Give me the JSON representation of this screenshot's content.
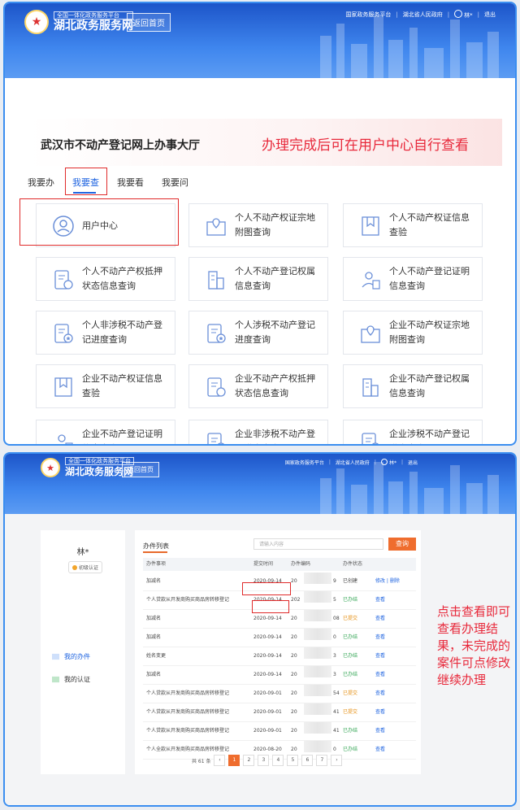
{
  "header": {
    "logo_top": "全国一体化政务服务平台",
    "logo_main": "湖北政务服务网",
    "home_button": "返回首页",
    "links": [
      "国家政务服务平台",
      "湖北省人民政府"
    ],
    "user": "林*",
    "logout": "退出"
  },
  "hall": {
    "title": "武汉市不动产登记网上办事大厅",
    "annotation": "办理完成后可在用户中心自行查看",
    "tabs": [
      "我要办",
      "我要查",
      "我要看",
      "我要问"
    ],
    "active_tab": "我要查"
  },
  "cards": [
    {
      "label": "用户中心",
      "icon": "user-circle-icon"
    },
    {
      "label": "个人不动产权证宗地附图查询",
      "icon": "map-pin-icon"
    },
    {
      "label": "个人不动产权证信息查验",
      "icon": "bookmark-icon"
    },
    {
      "label": "个人不动产产权抵押状态信息查询",
      "icon": "document-seal-icon"
    },
    {
      "label": "个人不动产登记权属信息查询",
      "icon": "building-icon"
    },
    {
      "label": "个人不动产登记证明信息查询",
      "icon": "user-doc-icon"
    },
    {
      "label": "个人非涉税不动产登记进度查询",
      "icon": "document-star-icon"
    },
    {
      "label": "个人涉税不动产登记进度查询",
      "icon": "document-star-icon"
    },
    {
      "label": "企业不动产权证宗地附图查询",
      "icon": "map-pin-icon"
    },
    {
      "label": "企业不动产权证信息查验",
      "icon": "bookmark-icon"
    },
    {
      "label": "企业不动产产权抵押状态信息查询",
      "icon": "document-seal-icon"
    },
    {
      "label": "企业不动产登记权属信息查询",
      "icon": "building-icon"
    },
    {
      "label": "企业不动产登记证明信息查询",
      "icon": "user-doc-icon"
    },
    {
      "label": "企业非涉税不动产登记进度查询",
      "icon": "document-star-icon"
    },
    {
      "label": "企业涉税不动产登记进度查询",
      "icon": "document-star-icon"
    }
  ],
  "center": {
    "user_name": "林*",
    "badge": "初级认证",
    "menu": [
      "我的办件",
      "我的认证"
    ],
    "list_title": "办件列表",
    "search_placeholder": "请输入内容",
    "search_button": "查询",
    "columns": [
      "办件事项",
      "提交时间",
      "办件编码",
      "办件状态",
      ""
    ],
    "rows": [
      {
        "item": "加减名",
        "date": "2020-09-14",
        "code_start": "20",
        "code_end": "9",
        "status": "已创建",
        "status_type": "created",
        "op": "修改 | 删除"
      },
      {
        "item": "个人贷款从开发商购买商品房转移登记",
        "date": "2020-09-14",
        "code_start": "202",
        "code_end": "5",
        "status": "已办结",
        "status_type": "done",
        "op": "查看"
      },
      {
        "item": "加减名",
        "date": "2020-09-14",
        "code_start": "20",
        "code_end": "08",
        "status": "已提交",
        "status_type": "submitted",
        "op": "查看"
      },
      {
        "item": "加减名",
        "date": "2020-09-14",
        "code_start": "20",
        "code_end": "0",
        "status": "已办结",
        "status_type": "done",
        "op": "查看"
      },
      {
        "item": "姓名变更",
        "date": "2020-09-14",
        "code_start": "20",
        "code_end": "3",
        "status": "已办结",
        "status_type": "done",
        "op": "查看"
      },
      {
        "item": "加减名",
        "date": "2020-09-14",
        "code_start": "20",
        "code_end": "3",
        "status": "已办结",
        "status_type": "done",
        "op": "查看"
      },
      {
        "item": "个人贷款从开发商购买商品房转移登记",
        "date": "2020-09-01",
        "code_start": "20",
        "code_end": "54",
        "status": "已提交",
        "status_type": "submitted",
        "op": "查看"
      },
      {
        "item": "个人贷款从开发商购买商品房转移登记",
        "date": "2020-09-01",
        "code_start": "20",
        "code_end": "41",
        "status": "已提交",
        "status_type": "submitted",
        "op": "查看"
      },
      {
        "item": "个人贷款从开发商购买商品房转移登记",
        "date": "2020-09-01",
        "code_start": "20",
        "code_end": "41",
        "status": "已办结",
        "status_type": "done",
        "op": "查看"
      },
      {
        "item": "个人全款从开发商购买商品房转移登记",
        "date": "2020-08-20",
        "code_start": "20",
        "code_end": "0",
        "status": "已办结",
        "status_type": "done",
        "op": "查看"
      }
    ],
    "pager": {
      "total": "共 61 条",
      "pages": [
        "1",
        "2",
        "3",
        "4",
        "5",
        "6",
        "7"
      ],
      "current": "1",
      "prev": "‹",
      "next": "›"
    },
    "annotation": "点击查看即可查看办理结果，未完成的案件可点修改继续办理"
  }
}
